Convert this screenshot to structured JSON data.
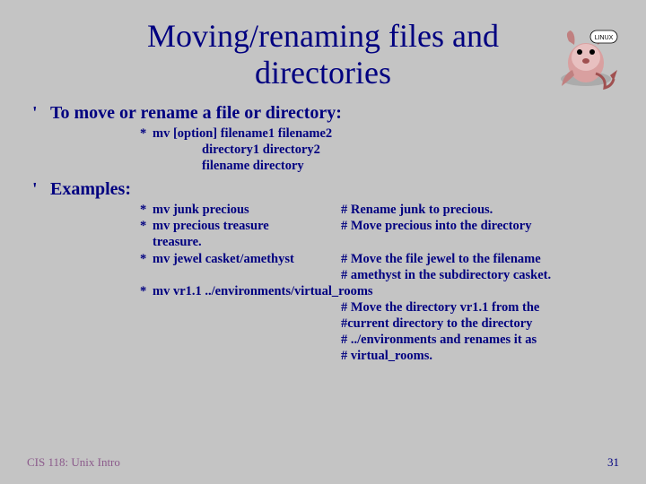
{
  "title_line1": "Moving/renaming files and",
  "title_line2": "directories",
  "section1": {
    "bullet": "'",
    "heading": "To move or rename a file or directory:",
    "syntax": {
      "star": "*",
      "line1": "mv [option] filename1 filename2",
      "line2": "directory1 directory2",
      "line3": "filename directory"
    }
  },
  "section2": {
    "bullet": "'",
    "heading": "Examples:",
    "ex1": {
      "star": "*",
      "cmd": "mv junk   precious",
      "comment": "# Rename junk to precious."
    },
    "ex2": {
      "star": "*",
      "cmd1": "mv precious treasure",
      "cmd2": "treasure.",
      "comment": "# Move precious into the directory"
    },
    "ex3": {
      "star": "*",
      "cmd": "mv jewel casket/amethyst",
      "comment1": "# Move the file jewel to the filename",
      "comment2": "# amethyst in the subdirectory casket."
    },
    "ex4": {
      "star": "*",
      "cmd": "mv vr1.1 ../environments/virtual_rooms",
      "comment1": "# Move the directory vr1.1 from the",
      "comment2": "#current directory to the directory",
      "comment3": "# ../environments and renames it as",
      "comment4": "# virtual_rooms."
    }
  },
  "footer": {
    "left": "CIS 118: Unix Intro",
    "right": "31"
  },
  "mascot_label": "LINUX"
}
